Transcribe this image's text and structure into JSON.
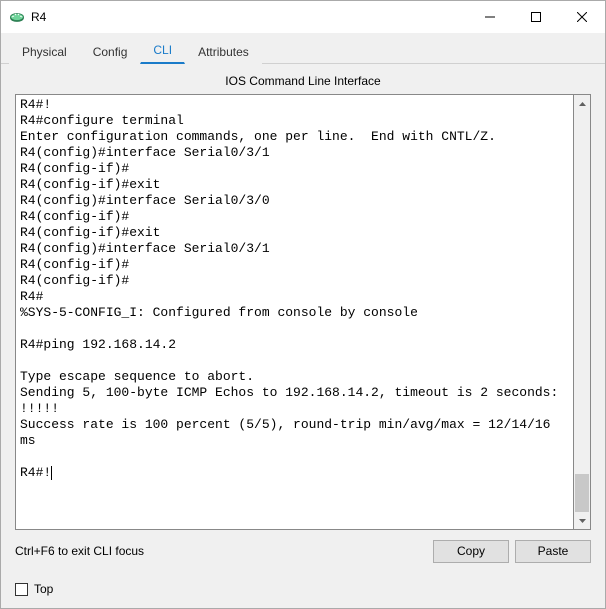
{
  "window": {
    "title": "R4"
  },
  "tabs": {
    "items": [
      {
        "label": "Physical"
      },
      {
        "label": "Config"
      },
      {
        "label": "CLI"
      },
      {
        "label": "Attributes"
      }
    ],
    "active_index": 2
  },
  "cli": {
    "header": "IOS Command Line Interface",
    "output": "R4#!\nR4#configure terminal\nEnter configuration commands, one per line.  End with CNTL/Z.\nR4(config)#interface Serial0/3/1\nR4(config-if)#\nR4(config-if)#exit\nR4(config)#interface Serial0/3/0\nR4(config-if)#\nR4(config-if)#exit\nR4(config)#interface Serial0/3/1\nR4(config-if)#\nR4(config-if)#\nR4#\n%SYS-5-CONFIG_I: Configured from console by console\n\nR4#ping 192.168.14.2\n\nType escape sequence to abort.\nSending 5, 100-byte ICMP Echos to 192.168.14.2, timeout is 2 seconds:\n!!!!!\nSuccess rate is 100 percent (5/5), round-trip min/avg/max = 12/14/16 ms\n\nR4#!",
    "helper_text": "Ctrl+F6 to exit CLI focus",
    "copy_label": "Copy",
    "paste_label": "Paste"
  },
  "footer": {
    "top_checkbox_label": "Top",
    "top_checked": false
  }
}
